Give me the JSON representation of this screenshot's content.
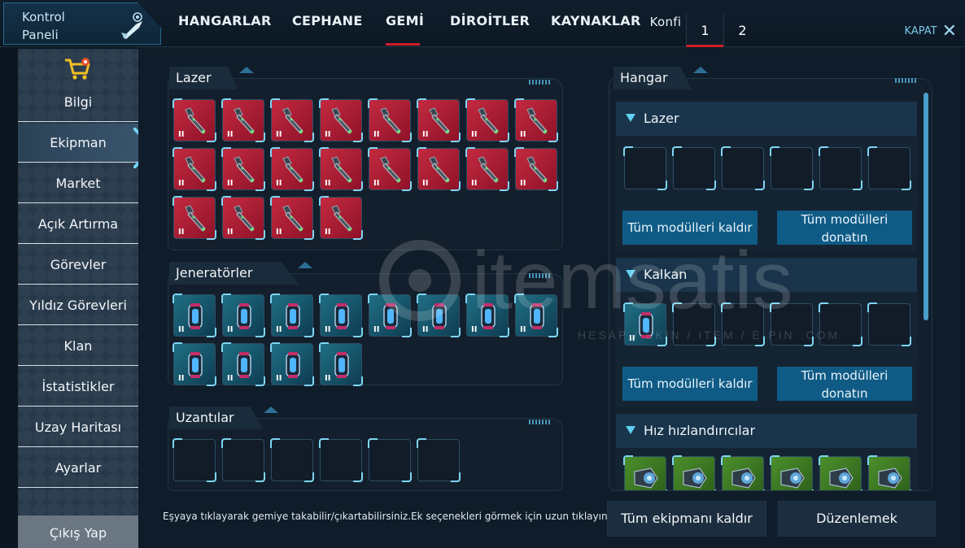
{
  "brand": {
    "title": "Kontrol Paneli"
  },
  "tabs": [
    {
      "label": "HANGARLAR",
      "active": false
    },
    {
      "label": "CEPHANE",
      "active": false
    },
    {
      "label": "GEMİ",
      "active": true
    },
    {
      "label": "DİROİTLER",
      "active": false
    },
    {
      "label": "KAYNAKLAR",
      "active": false
    }
  ],
  "config": {
    "label": "Konfi",
    "options": [
      "1",
      "2"
    ],
    "selected": "1"
  },
  "close": {
    "label": "KAPAT"
  },
  "sidebar": {
    "items": [
      {
        "label": "Bilgi"
      },
      {
        "label": "Ekipman",
        "active": true
      },
      {
        "label": "Market"
      },
      {
        "label": "Açık Artırma"
      },
      {
        "label": "Görevler"
      },
      {
        "label": "Yıldız Görevleri"
      },
      {
        "label": "Klan"
      },
      {
        "label": "İstatistikler"
      },
      {
        "label": "Uzay Haritası"
      },
      {
        "label": "Ayarlar"
      }
    ],
    "logout": "Çıkış Yap"
  },
  "ship": {
    "lasers": {
      "title": "Lazer",
      "filled": 20,
      "capacity": 20,
      "item_icon": "laser-cannon-icon",
      "level_mark": "II"
    },
    "generators": {
      "title": "Jeneratörler",
      "filled": 12,
      "capacity": 12,
      "item_icon": "shield-generator-icon",
      "level_mark": "II"
    },
    "extras": {
      "title": "Uzantılar",
      "filled": 0,
      "capacity": 6
    }
  },
  "hangar": {
    "title": "Hangar",
    "sections": [
      {
        "title": "Lazer",
        "slots_filled": 0,
        "slots_total": 6,
        "remove_label": "Tüm modülleri kaldır",
        "equip_label": "Tüm modülleri donatın"
      },
      {
        "title": "Kalkan",
        "slots_filled": 1,
        "slots_total": 6,
        "item_icon": "shield-generator-icon",
        "level_mark": "II",
        "remove_label": "Tüm modülleri kaldır",
        "equip_label": "Tüm modülleri donatın"
      },
      {
        "title": "Hız hızlandırıcılar",
        "slots_filled": 6,
        "slots_total": 6,
        "item_icon": "speed-booster-icon"
      }
    ]
  },
  "hint": "Eşyaya tıklayarak gemiye takabilir/çıkartabilirsiniz.Ek seçenekleri görmek için uzun tıklayın/sağ tıklayın",
  "footer": {
    "remove_all": "Tüm ekipmanı kaldır",
    "edit": "Düzenlemek"
  },
  "watermark": {
    "name": "itemsatis",
    "tagline": "HESAP / SKIN / ITEM / E-PIN .COM"
  },
  "colors": {
    "accent": "#d01e2a",
    "cyan": "#5fd0f0",
    "button": "#0f5b86",
    "laser_slot": "#b3223a",
    "gen_slot": "#1a6580",
    "booster_slot": "#4c8f2c"
  }
}
